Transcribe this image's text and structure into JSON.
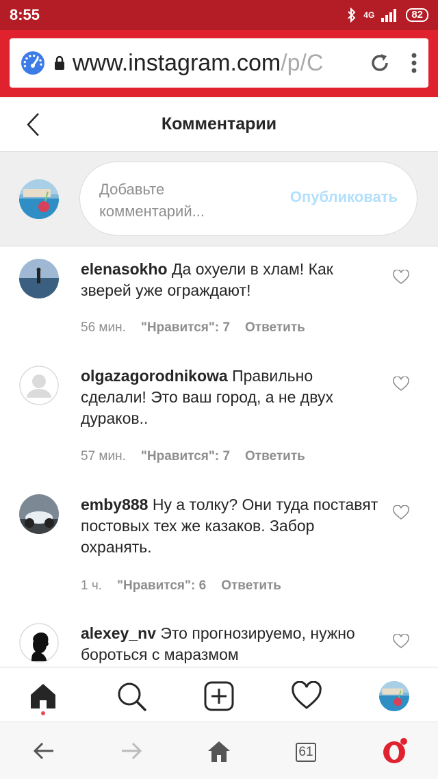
{
  "status_bar": {
    "time": "8:55",
    "network": "4G",
    "battery": "82"
  },
  "browser": {
    "url_main": "www.instagram.com",
    "url_dim": "/p/C"
  },
  "header": {
    "title": "Комментарии"
  },
  "composer": {
    "placeholder": "Добавьте комментарий...",
    "publish_label": "Опубликовать"
  },
  "comments": [
    {
      "user": "elenasokho",
      "text": "Да охуели в хлам! Как зверей уже ограждают!",
      "time": "56 мин.",
      "likes": "\"Нравится\": 7",
      "reply": "Ответить"
    },
    {
      "user": "olgazagorodnikowa",
      "text": "Правильно сделали! Это ваш город, а не двух дураков..",
      "time": "57 мин.",
      "likes": "\"Нравится\": 7",
      "reply": "Ответить"
    },
    {
      "user": "emby888",
      "text": "Ну а толку? Они туда поставят постовых тех же казаков. Забор охранять.",
      "time": "1 ч.",
      "likes": "\"Нравится\": 6",
      "reply": "Ответить"
    },
    {
      "user": "alexey_nv",
      "text": "Это прогнозируемо, нужно бороться с маразмом",
      "time": "",
      "likes": "",
      "reply": ""
    }
  ],
  "bottom_nav": {
    "items": [
      "home-icon",
      "search-icon",
      "add-post-icon",
      "activity-heart-icon",
      "profile-avatar"
    ]
  },
  "system_nav": {
    "tab_count": "61",
    "items": [
      "back-arrow-icon",
      "forward-arrow-icon",
      "home-icon",
      "tabs-icon",
      "opera-icon"
    ]
  },
  "colors": {
    "status_bar": "#b51d26",
    "browser_bar": "#e0222e",
    "publish": "#b2dffc",
    "notification_dot": "#ed4956"
  }
}
